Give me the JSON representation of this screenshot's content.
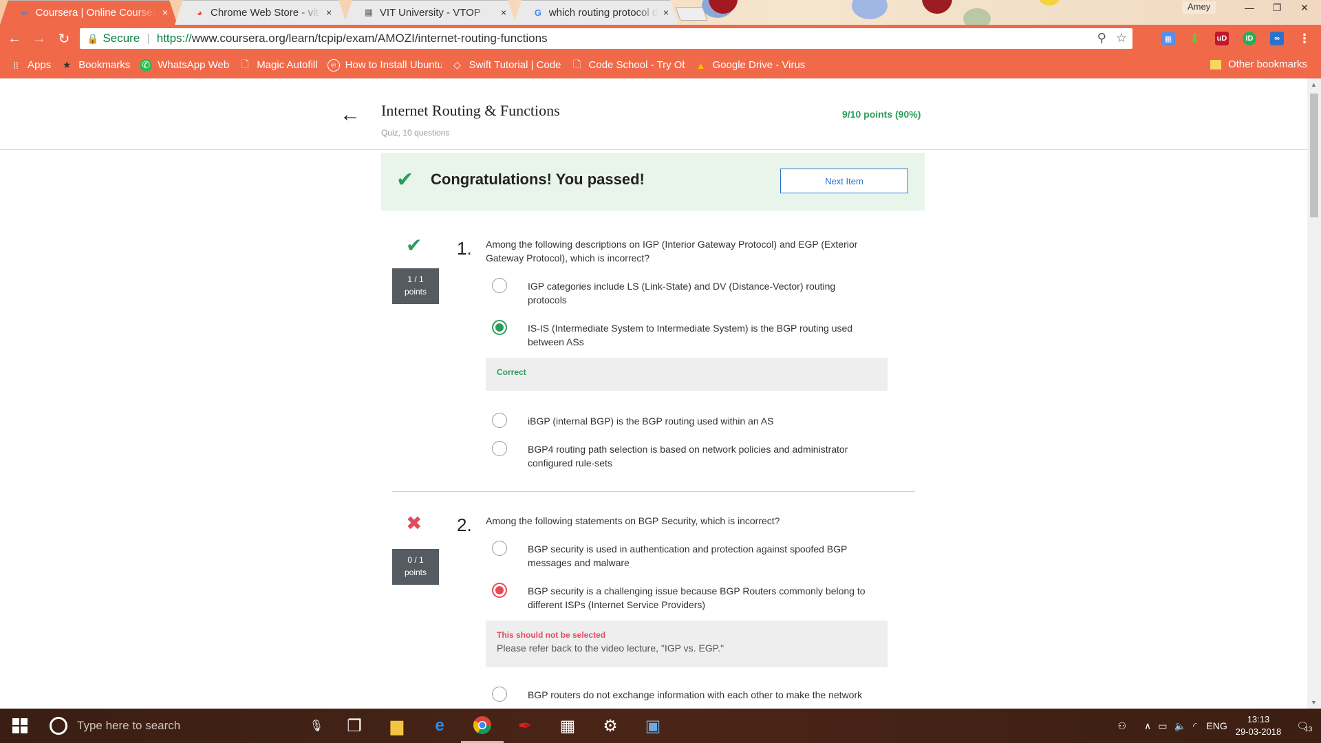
{
  "browser": {
    "tabs": [
      {
        "title": "Coursera | Online Courses",
        "active": true,
        "icon": "coursera-icon"
      },
      {
        "title": "Chrome Web Store - vit github",
        "active": false,
        "icon": "chrome-web-store-icon"
      },
      {
        "title": "VIT University - VTOP",
        "active": false,
        "icon": "vtop-icon"
      },
      {
        "title": "which routing protocol does",
        "active": false,
        "icon": "google-icon"
      }
    ],
    "close_glyph": "×",
    "profile_name": "Amey",
    "address": {
      "secure_label": "Secure",
      "protocol": "https://",
      "url": "www.coursera.org/learn/tcpip/exam/AMOZI/internet-routing-functions"
    },
    "bookmarks": [
      {
        "label": "Apps",
        "icon": "apps-grid-icon"
      },
      {
        "label": "Bookmarks",
        "icon": "star-icon"
      },
      {
        "label": "WhatsApp Web",
        "icon": "whatsapp-icon"
      },
      {
        "label": "Magic Autofill",
        "icon": "page-icon"
      },
      {
        "label": "How to Install Ubuntu",
        "icon": "dell-icon"
      },
      {
        "label": "Swift Tutorial | Code",
        "icon": "code-icon"
      },
      {
        "label": "Code School - Try Ob",
        "icon": "page-icon"
      },
      {
        "label": "Google Drive - Virus",
        "icon": "drive-icon"
      }
    ],
    "other_bookmarks": "Other bookmarks"
  },
  "quiz": {
    "title": "Internet Routing & Functions",
    "subtitle": "Quiz, 10 questions",
    "score": "9/10 points (90%)",
    "banner_message": "Congratulations! You passed!",
    "next_button": "Next Item"
  },
  "questions": [
    {
      "number": "1.",
      "points_line1": "1 / 1",
      "points_line2": "points",
      "status": "correct",
      "text": "Among the following descriptions on IGP (Interior Gateway Protocol) and EGP (Exterior Gateway Protocol), which is incorrect?",
      "options": [
        "IGP categories include LS (Link-State) and DV (Distance-Vector) routing protocols",
        "IS-IS (Intermediate System to Intermediate System) is the BGP routing used between ASs",
        "iBGP (internal BGP) is the BGP routing used within an AS",
        "BGP4 routing path selection is based on network policies and administrator configured rule-sets"
      ],
      "feedback_title": "Correct"
    },
    {
      "number": "2.",
      "points_line1": "0 / 1",
      "points_line2": "points",
      "status": "incorrect",
      "text": "Among the following statements on BGP Security, which is incorrect?",
      "options": [
        "BGP security is used in authentication and protection against spoofed BGP messages and malware",
        "BGP security is a challenging issue because BGP Routers commonly belong to different ISPs (Internet Service Providers)",
        "BGP routers do not exchange information with each other to make the network"
      ],
      "feedback_title": "This should not be selected",
      "feedback_body": "Please refer back to the video lecture, \"IGP vs. EGP.\""
    }
  ],
  "taskbar": {
    "search_placeholder": "Type here to search",
    "language": "ENG",
    "time": "13:13",
    "date": "29-03-2018",
    "notification_count": "13"
  }
}
